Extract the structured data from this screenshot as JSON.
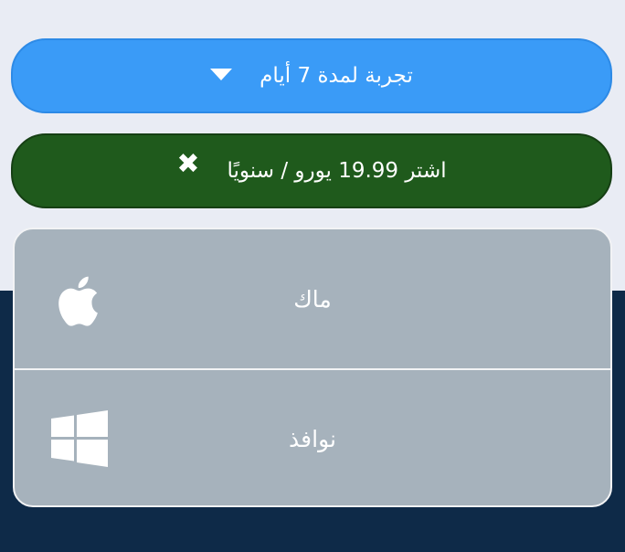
{
  "buttons": {
    "trial_label": "تجربة لمدة 7 أيام",
    "trial_icon": "caret-down-icon",
    "buy_label": "اشتر 19.99 يورو / سنويًا",
    "buy_icon": "close-icon",
    "buy_icon_glyph": "✖"
  },
  "platforms": [
    {
      "label": "ماك",
      "icon": "apple-icon"
    },
    {
      "label": "نوافذ",
      "icon": "windows-icon"
    }
  ],
  "colors": {
    "trial_button": "#3a9bf7",
    "buy_button": "#1f5a1c",
    "dropdown_bg": "#a6b2bc",
    "page_top_bg": "#e9ecf4",
    "page_bottom_bg": "#0e2a48"
  }
}
